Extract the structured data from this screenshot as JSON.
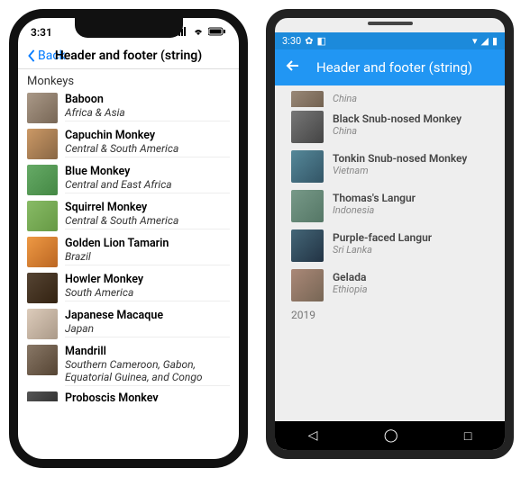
{
  "ios": {
    "time": "3:31",
    "back_label": "Back",
    "title": "Header and footer (string)",
    "list_header": "Monkeys",
    "items": [
      {
        "name": "Baboon",
        "location": "Africa & Asia"
      },
      {
        "name": "Capuchin Monkey",
        "location": "Central & South America"
      },
      {
        "name": "Blue Monkey",
        "location": "Central and East Africa"
      },
      {
        "name": "Squirrel Monkey",
        "location": "Central & South America"
      },
      {
        "name": "Golden Lion Tamarin",
        "location": "Brazil"
      },
      {
        "name": "Howler Monkey",
        "location": "South America"
      },
      {
        "name": "Japanese Macaque",
        "location": "Japan"
      },
      {
        "name": "Mandrill",
        "location": "Southern Cameroon, Gabon, Equatorial Guinea, and Congo"
      },
      {
        "name": "Proboscis Monkey",
        "location": ""
      }
    ]
  },
  "android": {
    "time": "3:30",
    "title": "Header and footer (string)",
    "items": [
      {
        "name": "",
        "location": "China"
      },
      {
        "name": "Black Snub-nosed Monkey",
        "location": "China"
      },
      {
        "name": "Tonkin Snub-nosed Monkey",
        "location": "Vietnam"
      },
      {
        "name": "Thomas's Langur",
        "location": "Indonesia"
      },
      {
        "name": "Purple-faced Langur",
        "location": "Sri Lanka"
      },
      {
        "name": "Gelada",
        "location": "Ethiopia"
      }
    ],
    "footer": "2019"
  }
}
